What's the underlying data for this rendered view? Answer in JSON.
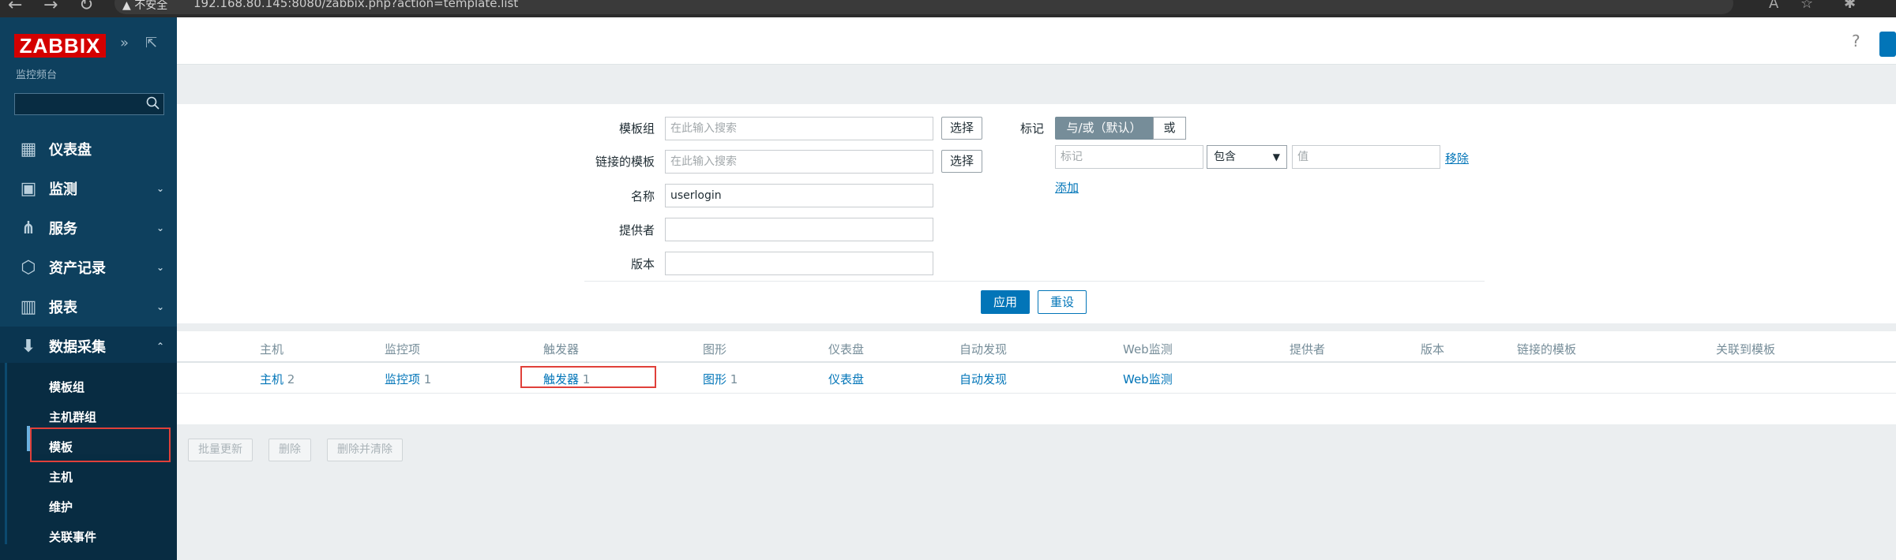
{
  "browser": {
    "security_label": "不安全",
    "url": "192.168.80.145:8080/zabbix.php?action=template.list"
  },
  "sidebar": {
    "logo": "ZABBIX",
    "subtitle": "监控频台",
    "search_placeholder": "",
    "menu": [
      {
        "label": "仪表盘",
        "icon": "dashboard-icon"
      },
      {
        "label": "监测",
        "icon": "monitoring-icon"
      },
      {
        "label": "服务",
        "icon": "services-icon"
      },
      {
        "label": "资产记录",
        "icon": "inventory-icon"
      },
      {
        "label": "报表",
        "icon": "reports-icon"
      },
      {
        "label": "数据采集",
        "icon": "data-collection-icon"
      }
    ],
    "submenu": [
      "模板组",
      "主机群组",
      "模板",
      "主机",
      "维护",
      "关联事件"
    ]
  },
  "topbar": {
    "help": "?"
  },
  "filter": {
    "template_group_label": "模板组",
    "template_group_placeholder": "在此输入搜索",
    "linked_templates_label": "链接的模板",
    "linked_templates_placeholder": "在此输入搜索",
    "select_label": "选择",
    "name_label": "名称",
    "name_value": "userlogin",
    "vendor_label": "提供者",
    "version_label": "版本",
    "tags_label": "标记",
    "tags_andor": "与/或（默认）",
    "tags_or": "或",
    "tag_placeholder": "标记",
    "tag_operator": "包含",
    "value_placeholder": "值",
    "remove_label": "移除",
    "add_label": "添加",
    "apply_label": "应用",
    "reset_label": "重设"
  },
  "table": {
    "headers": [
      "主机",
      "监控项",
      "触发器",
      "图形",
      "仪表盘",
      "自动发现",
      "Web监测",
      "提供者",
      "版本",
      "链接的模板",
      "关联到模板"
    ],
    "row": {
      "hosts": "主机",
      "hosts_count": "2",
      "items": "监控项",
      "items_count": "1",
      "triggers": "触发器",
      "triggers_count": "1",
      "graphs": "图形",
      "graphs_count": "1",
      "dashboards": "仪表盘",
      "discovery": "自动发现",
      "web": "Web监测"
    }
  },
  "mass_actions": {
    "mass_update": "批量更新",
    "delete": "删除",
    "delete_clear": "删除并清除"
  },
  "colors": {
    "sidebar_bg": "#0e405e",
    "accent": "#0275b8",
    "logo_red": "#d40000",
    "highlight_red": "#e0403a"
  }
}
